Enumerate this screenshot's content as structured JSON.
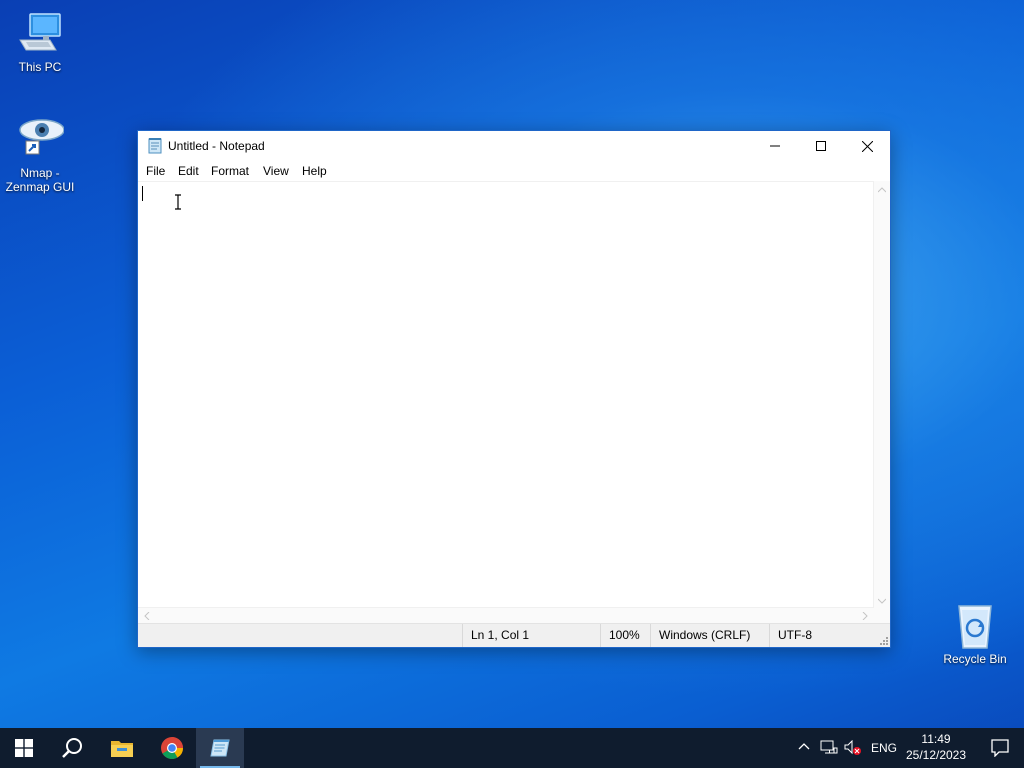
{
  "desktop": {
    "icons": [
      {
        "label": "This PC",
        "icon": "computer-icon"
      },
      {
        "label": "Nmap -\nZenmap GUI",
        "icon": "nmap-eye-icon"
      },
      {
        "label": "Recycle Bin",
        "icon": "recycle-bin-icon"
      }
    ]
  },
  "window": {
    "title": "Untitled - Notepad",
    "app_icon": "notepad-icon",
    "menu": [
      "File",
      "Edit",
      "Format",
      "View",
      "Help"
    ],
    "content": "",
    "status": {
      "position": "Ln 1, Col 1",
      "zoom": "100%",
      "line_endings": "Windows (CRLF)",
      "encoding": "UTF-8"
    }
  },
  "taskbar": {
    "apps": [
      {
        "name": "start",
        "icon": "windows-logo-icon"
      },
      {
        "name": "search",
        "icon": "search-icon"
      },
      {
        "name": "file-explorer",
        "icon": "folder-icon"
      },
      {
        "name": "chrome",
        "icon": "chrome-icon"
      },
      {
        "name": "notepad",
        "icon": "notepad-icon",
        "active": true
      }
    ],
    "tray": {
      "language": "ENG",
      "time": "11:49",
      "date": "25/12/2023"
    }
  },
  "colors": {
    "accent": "#0078d7",
    "taskbar": "#0f1c2e"
  }
}
